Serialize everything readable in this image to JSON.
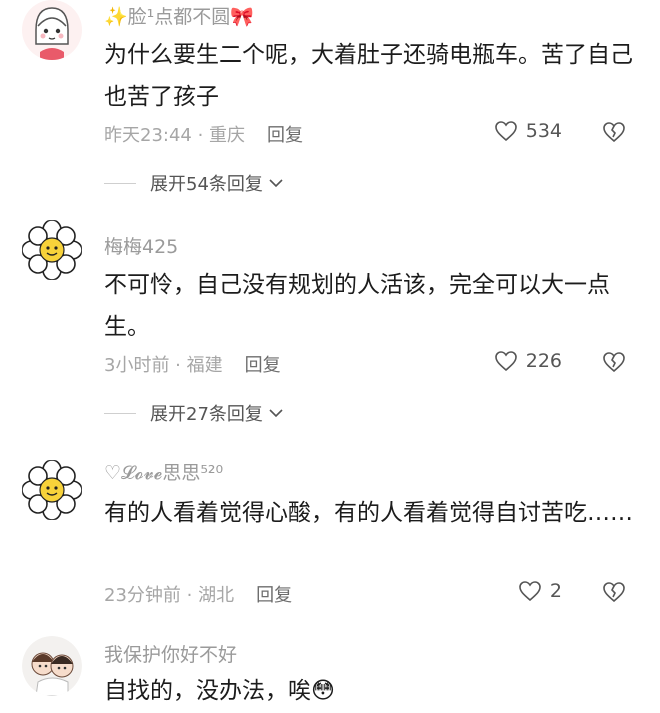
{
  "comments": [
    {
      "name": "✨脸¹点都不圆🎀",
      "text": "为什么要生二个呢，大着肚子还骑电瓶车。苦了自己也苦了孩子",
      "time": "昨天23:44",
      "location": "重庆",
      "reply_label": "回复",
      "likes": "534",
      "expand_label": "展开54条回复"
    },
    {
      "name": "梅梅425",
      "text": "不可怜，自己没有规划的人活该，完全可以大一点生。",
      "time": "3小时前",
      "location": "福建",
      "reply_label": "回复",
      "likes": "226",
      "expand_label": "展开27条回复"
    },
    {
      "name": "♡𝓛𝓸𝓿𝓮思思⁵²⁰",
      "text": "有的人看着觉得心酸，有的人看着觉得自讨苦吃……",
      "time": "23分钟前",
      "location": "湖北",
      "reply_label": "回复",
      "likes": "2"
    },
    {
      "name": "我保护你好不好",
      "text": "自找的，没办法，唉😳"
    }
  ],
  "meta_separator": " · ",
  "icons": {
    "like": "heart-outline-icon",
    "dislike": "broken-heart-icon",
    "expand": "chevron-down-icon"
  },
  "colors": {
    "text": "#1c1c1c",
    "muted": "#a6a6a6",
    "name": "#9a9a9a"
  }
}
